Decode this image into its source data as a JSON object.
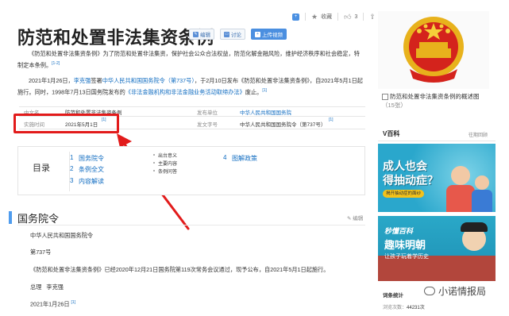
{
  "header": {
    "title": "防范和处置非法集资条例",
    "edit_label": "编辑",
    "discuss_label": "讨论",
    "upload_video_label": "上传视频",
    "collect_label": "收藏",
    "like_count": "3",
    "share_count": "42"
  },
  "intro": {
    "p1_a": "《防范和处置非法集资条例》为了防范和处置非法集资，保护社会公众合法权益，防范化解金融风险，维护经济秩序和社会稳定，特制定本条例。",
    "p1_ref": "[1-2]",
    "p2_a": "2021年1月26日，",
    "p2_link1": "李克强",
    "p2_b": "签署",
    "p2_link2": "中华人民共和国国务院令（第737号）",
    "p2_c": "，于2月10日发布《防范和处置非法集资条例》，自2021年5月1日起施行。同时，1998年7月13日国务院发布的",
    "p2_link3": "《非法金融机构和非法金融业务活动取缔办法》",
    "p2_d": "废止。",
    "p2_ref": "[1]"
  },
  "info": {
    "k1": "中文名",
    "v1": "防范和处置非法集资条例",
    "k2": "发布单位",
    "v2": "中华人民共和国国务院",
    "k3": "实施时间",
    "v3": "2021年5月1日",
    "v3_ref": "[1]",
    "k4": "发文字号",
    "v4": "中华人民共和国国务院令（第737号）",
    "v4_ref": "[1]"
  },
  "toc": {
    "label": "目录",
    "items": [
      {
        "num": "1",
        "label": "国务院令"
      },
      {
        "num": "2",
        "label": "条例全文"
      },
      {
        "num": "3",
        "label": "内容解读"
      },
      {
        "num": "4",
        "label": "图解政策"
      }
    ],
    "subs": [
      "出台意义",
      "主要内容",
      "条例问答"
    ]
  },
  "section": {
    "title": "国务院令",
    "edit_label": "编辑",
    "line1": "中华人民共和国国务院令",
    "line2": "第737号",
    "line3": "《防范和处置非法集资条例》已经2020年12月21日国务院第119次常务会议通过，现予公布，自2021年5月1日起施行。",
    "line4_a": "总理",
    "line4_b": "李克强",
    "line5": "2021年1月26日",
    "line5_ref": "[1]"
  },
  "sidebar": {
    "overview_link": "防范和处置非法集资条例的概述图",
    "overview_count": "（15张）",
    "vbaike": "V百科",
    "vbaike_more": "往期回顾",
    "ad1_title_1": "成人也会",
    "ad1_title_2": "得抽动症？",
    "ad1_sub": "揭开抽动症的面纱",
    "ad2_brand": "秒懂百科",
    "ad2_title": "趣味明朝",
    "ad2_sub": "让孩子玩着学历史",
    "stat_title": "词条统计",
    "stat_views_label": "浏览次数：",
    "stat_views": "44231次"
  },
  "watermark": "小诺情报局",
  "colors": {
    "accent": "#136ec2",
    "highlight": "#e21b1b",
    "section_bar": "#4f9cee"
  }
}
